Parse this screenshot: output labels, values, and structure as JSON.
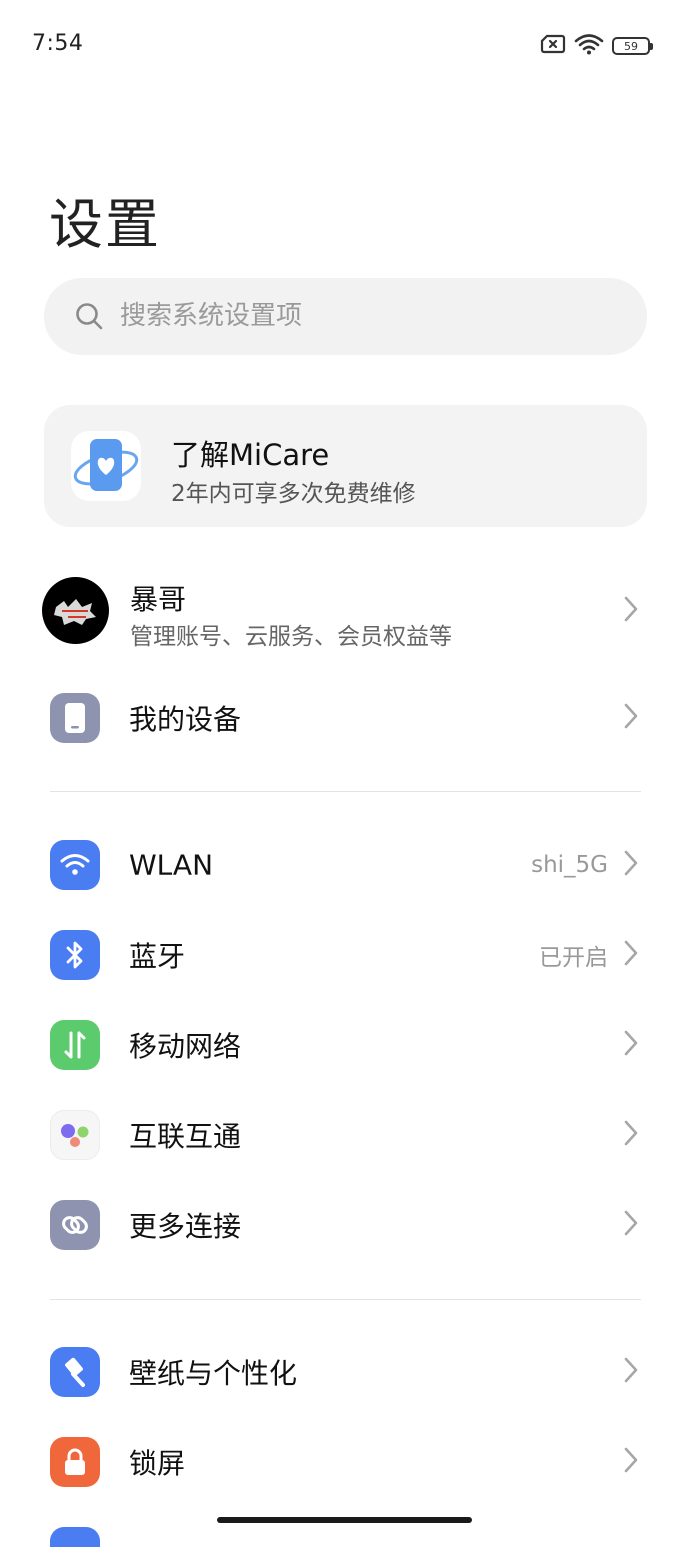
{
  "status_bar": {
    "time": "7:54",
    "battery": "59",
    "icons": [
      "sim-off-icon",
      "wifi-icon",
      "battery-icon"
    ]
  },
  "page_title": "设置",
  "search": {
    "placeholder": "搜索系统设置项",
    "value": ""
  },
  "promo": {
    "title": "了解MiCare",
    "subtitle": "2年内可享多次免费维修",
    "icon": "micare-icon"
  },
  "account": {
    "name": "暴哥",
    "subtitle": "管理账号、云服务、会员权益等"
  },
  "items": [
    {
      "label": "我的设备",
      "value": "",
      "icon": "device-icon",
      "color": "#8e94b0"
    },
    {
      "label": "WLAN",
      "value": "shi_5G",
      "icon": "wifi-icon",
      "color": "#4a7df2"
    },
    {
      "label": "蓝牙",
      "value": "已开启",
      "icon": "bluetooth-icon",
      "color": "#4a7df2"
    },
    {
      "label": "移动网络",
      "value": "",
      "icon": "mobile-data-icon",
      "color": "#5ccb6e"
    },
    {
      "label": "互联互通",
      "value": "",
      "icon": "interconnect-icon",
      "color": "#f6f6f6"
    },
    {
      "label": "更多连接",
      "value": "",
      "icon": "link-icon",
      "color": "#8e94b0"
    },
    {
      "label": "壁纸与个性化",
      "value": "",
      "icon": "brush-icon",
      "color": "#4a7df2"
    },
    {
      "label": "锁屏",
      "value": "",
      "icon": "lock-icon",
      "color": "#f0673c"
    }
  ]
}
